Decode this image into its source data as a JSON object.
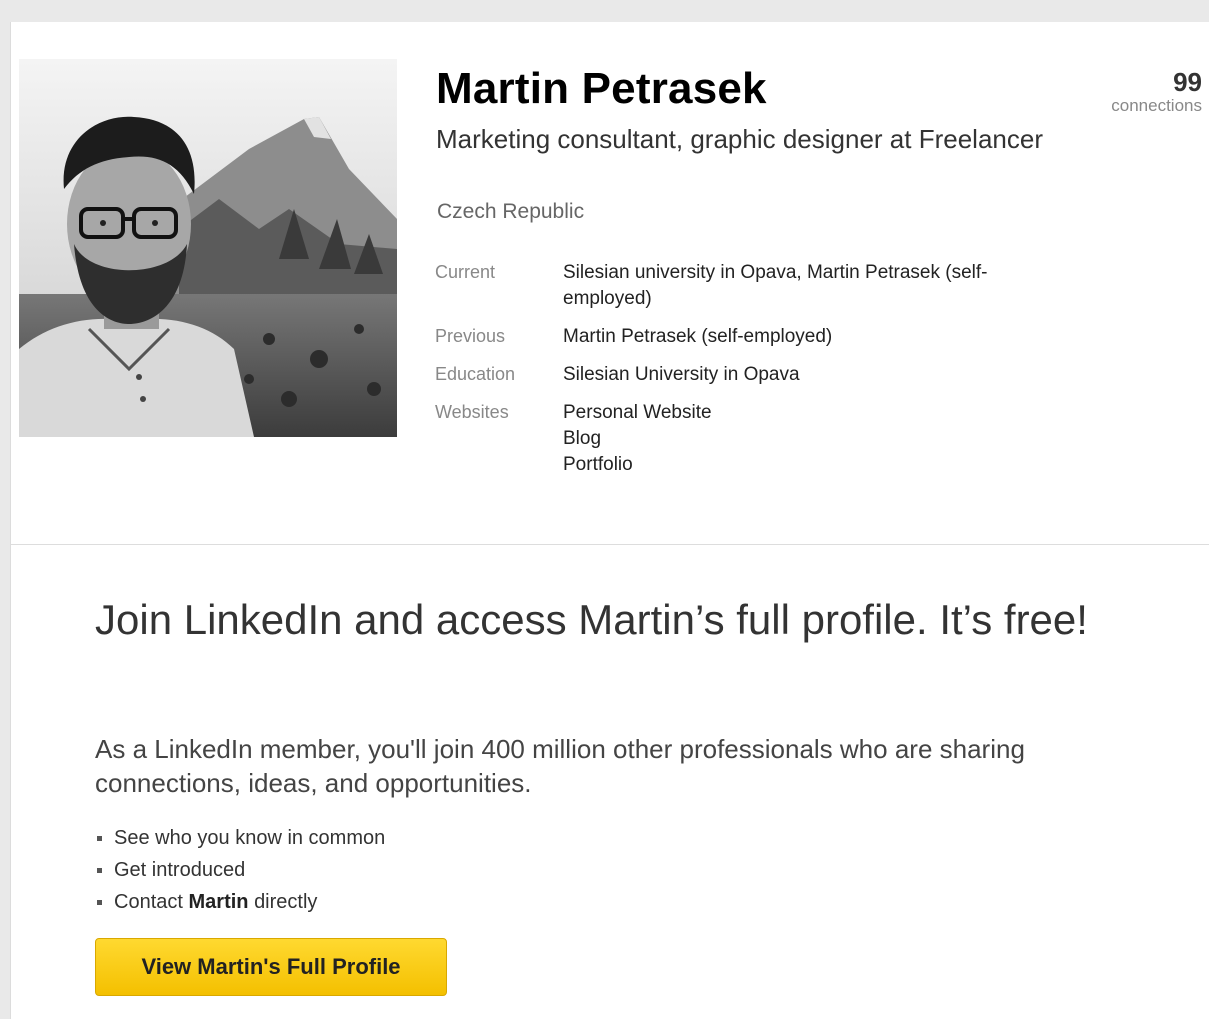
{
  "profile": {
    "name": "Martin Petrasek",
    "headline": "Marketing consultant, graphic designer at Freelancer",
    "location": "Czech Republic",
    "connections": {
      "count": "99",
      "label": "connections"
    },
    "details": {
      "current": {
        "label": "Current",
        "value": "Silesian university in Opava, Martin Petrasek (self-employed)"
      },
      "previous": {
        "label": "Previous",
        "value": "Martin Petrasek (self-employed)"
      },
      "education": {
        "label": "Education",
        "value": "Silesian University in Opava"
      },
      "websites": {
        "label": "Websites",
        "items": [
          "Personal Website",
          "Blog",
          "Portfolio"
        ]
      }
    }
  },
  "join": {
    "title": "Join LinkedIn and access Martin’s full profile. It’s free!",
    "subtitle": "As a LinkedIn member, you'll join 400 million other professionals who are sharing connections, ideas, and opportunities.",
    "benefits": [
      "See who you know in common",
      "Get introduced"
    ],
    "contact": {
      "prefix": "Contact",
      "name": "Martin",
      "suffix": "directly"
    },
    "cta_label": "View Martin's Full Profile"
  },
  "colors": {
    "cta_background": "#f4c000",
    "page_background": "#e9e9e9"
  }
}
